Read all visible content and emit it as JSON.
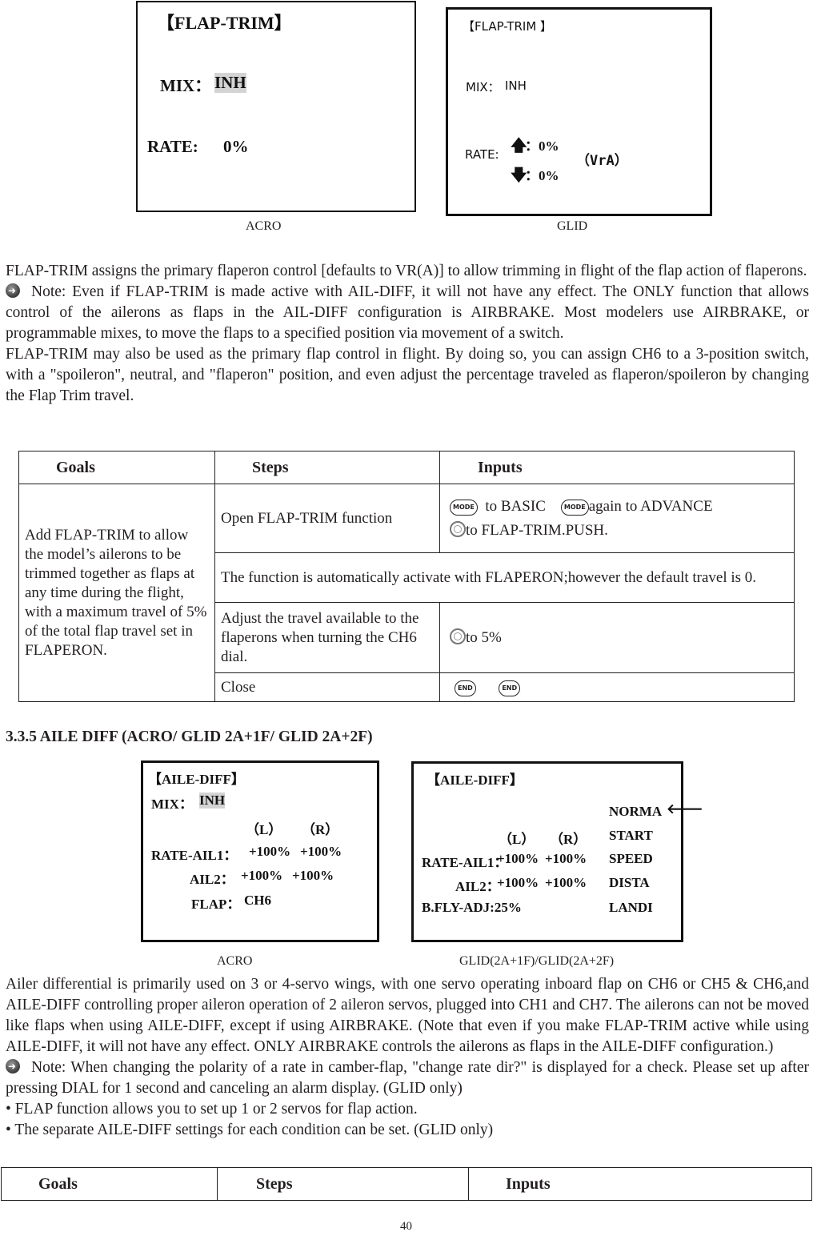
{
  "page_number": "40",
  "flap_trim": {
    "screens": [
      {
        "caption": "ACRO",
        "title": "【FLAP-TRIM】",
        "mix_label": "MIX：",
        "mix_value": "INH",
        "rate_label": "RATE:",
        "rate_value": "0%"
      },
      {
        "caption": "GLID",
        "title": "【FLAP-TRIM 】",
        "mix_label": "MIX：",
        "mix_value": "INH",
        "rate_label": "RATE:",
        "rate_up": "：0%",
        "rate_down": "：0%",
        "control": "（VrA）"
      }
    ],
    "paragraphs": [
      "FLAP-TRIM assigns the primary flaperon control [defaults to VR(A)] to allow trimming in flight of the flap action of flaperons.",
      "Note: Even if FLAP-TRIM is made active with AIL-DIFF, it will not have any effect. The ONLY function that allows control of the ailerons as flaps in the AIL-DIFF configuration is AIRBRAKE. Most modelers use AIRBRAKE, or programmable mixes, to move the flaps to a specified position via movement of a switch.",
      "FLAP-TRIM may also be used as the primary flap control in flight. By doing so, you can assign CH6 to a 3-position switch, with a \"spoileron\", neutral, and \"flaperon\" position, and even adjust the percentage traveled as flaperon/spoileron by changing the Flap Trim travel."
    ],
    "table": {
      "headers": [
        "Goals",
        "Steps",
        "Inputs"
      ],
      "goal": "Add FLAP-TRIM to allow the model’s ailerons to be trimmed together as flaps at any time during the flight, with a maximum travel of 5% of the total flap travel set in FLAPERON.",
      "rows": [
        {
          "step": "Open FLAP-TRIM function",
          "input_a": "to BASIC",
          "input_b": "again to ADVANCE",
          "input_c": "to FLAP-TRIM.PUSH."
        },
        {
          "merged": "The function is automatically activate with FLAPERON;however the default travel is 0."
        },
        {
          "step": "Adjust the travel available to the flaperons when turning the CH6 dial.",
          "input": "to 5%"
        },
        {
          "step": "Close"
        }
      ],
      "button_labels": {
        "mode": "MODE",
        "end": "END"
      }
    }
  },
  "aile_diff": {
    "heading": "3.3.5 AILE DIFF (ACRO/ GLID 2A+1F/ GLID 2A+2F)",
    "screens": [
      {
        "caption": "ACRO",
        "title": "【AILE-DIFF】",
        "mix_label": "MIX：",
        "mix_value": "INH",
        "col_l": "（L）",
        "col_r": "（R）",
        "rate_ail1_label": "RATE-AIL1：",
        "rate_ail1_l": "+100%",
        "rate_ail1_r": "+100%",
        "ail2_label": "AIL2：",
        "ail2_l": "+100%",
        "ail2_r": "+100%",
        "flap_label": "FLAP：",
        "flap_value": "CH6"
      },
      {
        "caption": "GLID(2A+1F)/GLID(2A+2F)",
        "title": "【AILE-DIFF】",
        "col_l": "（L）",
        "col_r": "（R）",
        "rate_ail1_label": "RATE-AIL1：",
        "rate_ail1_l": "+100%",
        "rate_ail1_r": "+100%",
        "ail2_label": "AIL2：",
        "ail2_l": "+100%",
        "ail2_r": "+100%",
        "bfly_label": "B.FLY-ADJ:25%",
        "conditions": [
          "NORMA",
          "START",
          "SPEED",
          "DISTA",
          "LANDI"
        ],
        "selected_condition": "NORMA"
      }
    ],
    "paragraphs": [
      "Ailer differential is primarily used on 3 or 4-servo wings, with one servo operating inboard flap on CH6 or CH5 & CH6,and AILE-DIFF controlling proper aileron operation of 2 aileron servos, plugged into CH1 and CH7. The ailerons can not be moved like flaps when using AILE-DIFF, except if using AIRBRAKE. (Note that even if you make FLAP-TRIM active while using AILE-DIFF, it will not have any effect. ONLY AIRBRAKE controls the ailerons as flaps in the AILE-DIFF configuration.)",
      "Note: When changing the polarity of a rate in camber-flap, \"change rate dir?\" is displayed for a check. Please set up after pressing DIAL for 1 second and canceling an alarm display. (GLID only)",
      "• FLAP function allows you to set up 1 or 2 servos for flap action.",
      "• The separate AILE-DIFF settings for each condition can be set. (GLID only)"
    ],
    "table": {
      "headers": [
        "Goals",
        "Steps",
        "Inputs"
      ]
    }
  }
}
